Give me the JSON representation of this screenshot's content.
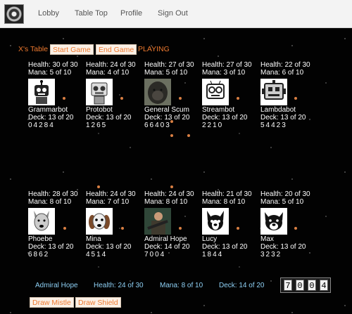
{
  "nav": {
    "links": [
      "Lobby",
      "Table Top",
      "Profile",
      "Sign Out"
    ]
  },
  "table": {
    "name": "X's Table",
    "start_label": "Start Game",
    "end_label": "End Game",
    "status": "PLAYING"
  },
  "top_players": [
    {
      "name": "Grammarbot",
      "health": "Health: 30 of 30",
      "mana": "Mana: 5 of 10",
      "deck": "Deck: 13 of 20",
      "cards": "04284",
      "avatar": "robot-icon"
    },
    {
      "name": "Protobot",
      "health": "Health: 24 of 30",
      "mana": "Mana: 4 of 10",
      "deck": "Deck: 13 of 20",
      "cards": "1265",
      "avatar": "robot-icon"
    },
    {
      "name": "General Scum",
      "health": "Health: 27 of 30",
      "mana": "Mana: 5 of 10",
      "deck": "Deck: 13 of 20",
      "cards": "66403",
      "avatar": "gorilla-photo"
    },
    {
      "name": "Streambot",
      "health": "Health: 27 of 30",
      "mana": "Mana: 3 of 10",
      "deck": "Deck: 13 of 20",
      "cards": "2210",
      "avatar": "robot-icon"
    },
    {
      "name": "Lambdabot",
      "health": "Health: 22 of 30",
      "mana": "Mana: 6 of 10",
      "deck": "Deck: 13 of 20",
      "cards": "54423",
      "avatar": "robot-icon"
    }
  ],
  "bottom_players": [
    {
      "name": "Phoebe",
      "health": "Health: 28 of 30",
      "mana": "Mana: 8 of 10",
      "deck": "Deck: 13 of 20",
      "cards": "6862",
      "avatar": "dog-icon"
    },
    {
      "name": "Mina",
      "health": "Health: 24 of 30",
      "mana": "Mana: 7 of 10",
      "deck": "Deck: 13 of 20",
      "cards": "4514",
      "avatar": "dog-icon"
    },
    {
      "name": "Admiral Hope",
      "health": "Health: 24 of 30",
      "mana": "Mana: 8 of 10",
      "deck": "Deck: 14 of 20",
      "cards": "7004",
      "avatar": "soldier-photo"
    },
    {
      "name": "Lucy",
      "health": "Health: 21 of 30",
      "mana": "Mana: 8 of 10",
      "deck": "Deck: 13 of 20",
      "cards": "1844",
      "avatar": "dog-icon"
    },
    {
      "name": "Max",
      "health": "Health: 20 of 30",
      "mana": "Mana: 5 of 10",
      "deck": "Deck: 13 of 20",
      "cards": "3232",
      "avatar": "dog-icon"
    }
  ],
  "me": {
    "name": "Admiral Hope",
    "health": "Health: 24 of 30",
    "mana": "Mana: 8 of 10",
    "deck": "Deck: 14 of 20",
    "hand": [
      "7",
      "0",
      "0",
      "4"
    ]
  },
  "actions": {
    "mistle": "Draw Mistle",
    "shield": "Draw Shield"
  }
}
